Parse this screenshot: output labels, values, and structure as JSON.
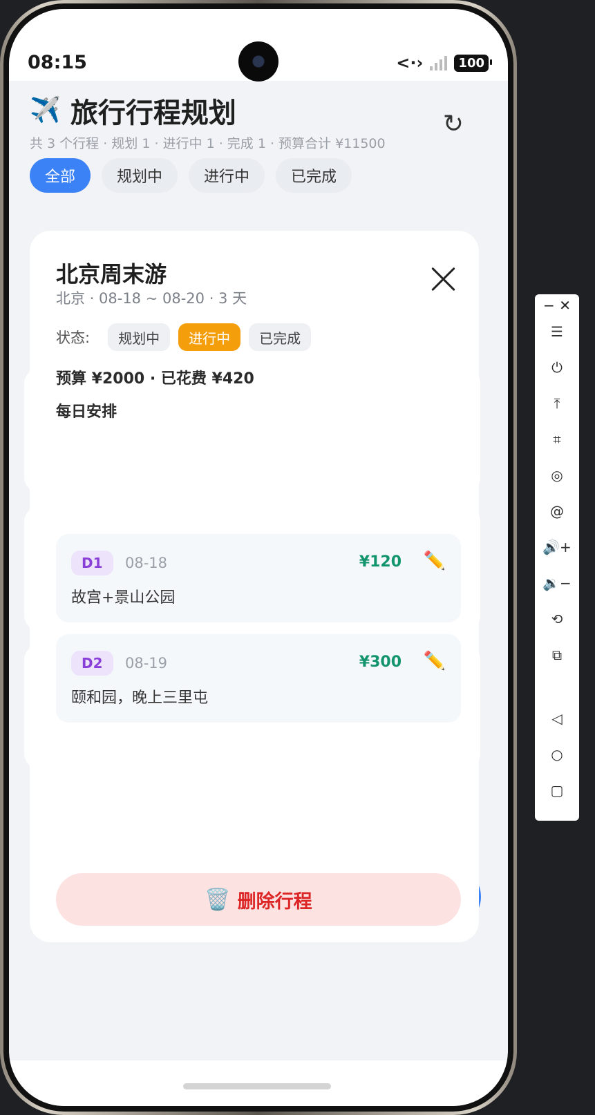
{
  "status_bar": {
    "time": "08:15",
    "network_icon": "<·›",
    "battery": "100"
  },
  "header": {
    "icon": "✈️",
    "title": "旅行行程规划",
    "summary": "共 3 个行程 · 规划 1 · 进行中 1 · 完成 1 · 预算合计 ¥11500",
    "refresh_icon": "↻"
  },
  "filters": [
    {
      "label": "全部",
      "active": true
    },
    {
      "label": "规划中",
      "active": false
    },
    {
      "label": "进行中",
      "active": false
    },
    {
      "label": "已完成",
      "active": false
    }
  ],
  "trip": {
    "name": "北京周末游",
    "meta": "北京 · 08-18 ~ 08-20 · 3 天",
    "status_label": "状态:",
    "status_options": [
      "规划中",
      "进行中",
      "已完成"
    ],
    "current_status": "进行中",
    "budget_line": "预算 ¥2000 · 已花费 ¥420",
    "daily_heading": "每日安排",
    "days": [
      {
        "badge": "D1",
        "date": "08-18",
        "cost": "¥120",
        "desc": "故宫+景山公园"
      },
      {
        "badge": "D2",
        "date": "08-19",
        "cost": "¥300",
        "desc": "颐和园，晚上三里屯"
      }
    ],
    "delete_icon": "🗑️",
    "delete_label": "删除行程"
  },
  "colors": {
    "primary": "#3b82f6",
    "status_active": "#f59e0b",
    "cost_green": "#13956b",
    "delete_red": "#dc2626"
  },
  "toolbar": {
    "minimize": "−",
    "close": "✕",
    "items": [
      "☰",
      "⏻",
      "⤒",
      "⌗",
      "◎",
      "@",
      "🔊+",
      "🔉−",
      "⟲",
      "⧉"
    ],
    "nav_items": [
      "◁",
      "○",
      "▢"
    ]
  }
}
